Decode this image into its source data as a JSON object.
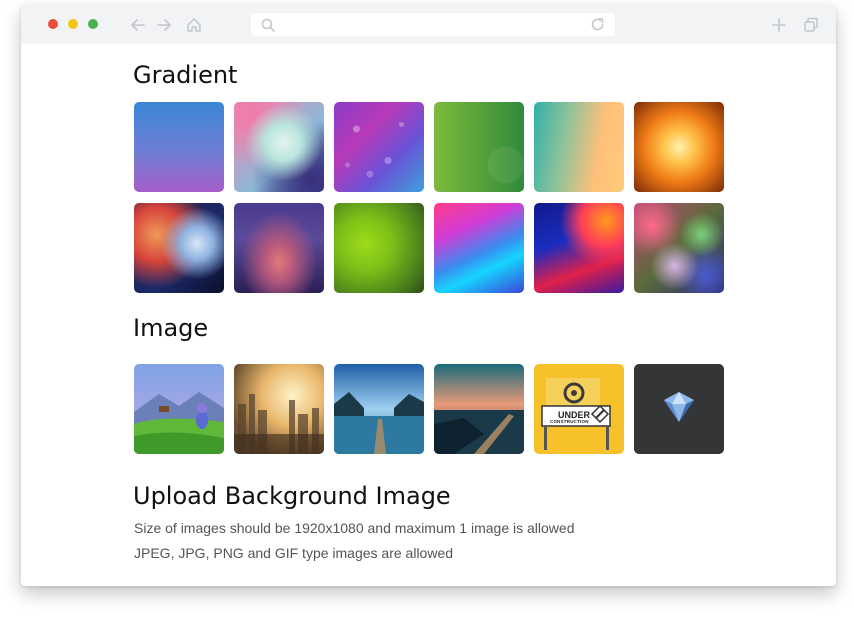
{
  "browser": {
    "address_value": "",
    "icons": {
      "back": "arrow-left-icon",
      "forward": "arrow-right-icon",
      "home": "home-icon",
      "search": "search-icon",
      "reload": "reload-icon",
      "new_tab": "plus-icon",
      "tabs": "tabs-icon"
    },
    "traffic_lights": [
      "#e94e36",
      "#f5c518",
      "#4caf50"
    ]
  },
  "sections": {
    "gradient": {
      "title": "Gradient",
      "tiles": [
        {
          "name": "blue-purple"
        },
        {
          "name": "pastel-pink-teal"
        },
        {
          "name": "purple-bokeh"
        },
        {
          "name": "green"
        },
        {
          "name": "teal-peach"
        },
        {
          "name": "fire-orange"
        },
        {
          "name": "red-blue-blur"
        },
        {
          "name": "purple-dusk"
        },
        {
          "name": "lime-green"
        },
        {
          "name": "pink-blue-wave"
        },
        {
          "name": "blue-red-wave"
        },
        {
          "name": "colorful-bokeh"
        }
      ]
    },
    "image": {
      "title": "Image",
      "tiles": [
        {
          "name": "game-character-meadow"
        },
        {
          "name": "misty-city"
        },
        {
          "name": "lake-pier"
        },
        {
          "name": "coastal-city-dusk"
        },
        {
          "name": "under-construction",
          "text": "UNDER",
          "subtext": "CONSTRUCTION"
        },
        {
          "name": "diamond-logo"
        }
      ]
    },
    "upload": {
      "title": "Upload Background Image",
      "size_note": "Size of images should be 1920x1080 and maximum 1 image is allowed",
      "type_note": "JPEG, JPG, PNG and GIF type images are allowed"
    }
  }
}
